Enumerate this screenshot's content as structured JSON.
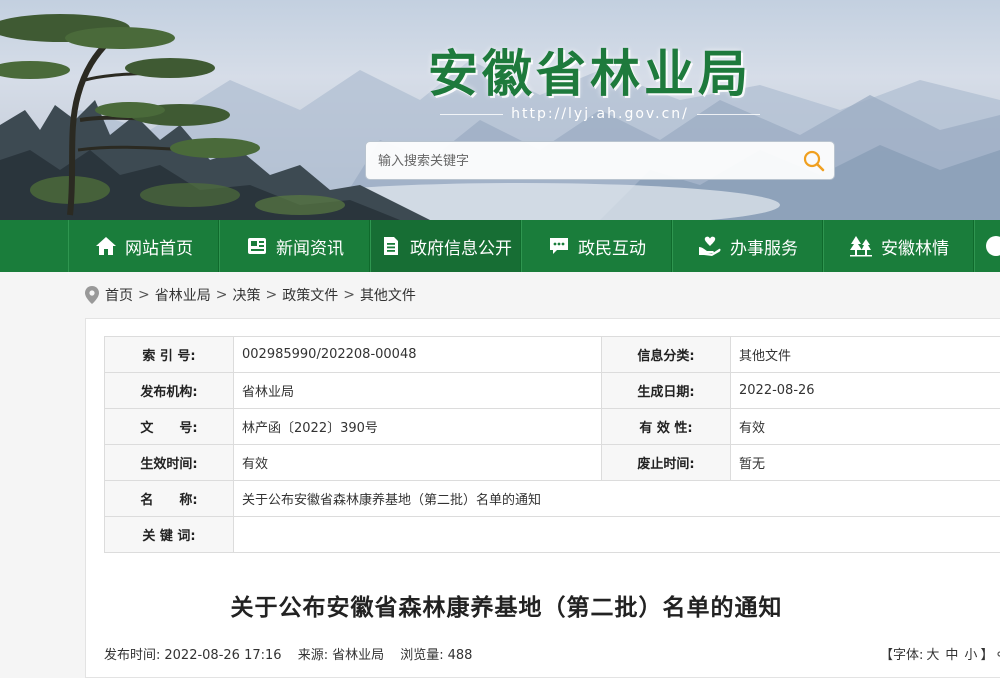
{
  "header": {
    "title": "安徽省林业局",
    "url": "http://lyj.ah.gov.cn/",
    "search": {
      "placeholder": "输入搜索关键字"
    }
  },
  "nav": {
    "items": [
      {
        "label": "网站首页",
        "icon": "home-icon"
      },
      {
        "label": "新闻资讯",
        "icon": "news-icon"
      },
      {
        "label": "政府信息公开",
        "icon": "document-icon"
      },
      {
        "label": "政民互动",
        "icon": "chat-icon"
      },
      {
        "label": "办事服务",
        "icon": "heart-hand-icon"
      },
      {
        "label": "安徽林情",
        "icon": "forest-icon"
      }
    ]
  },
  "breadcrumb": [
    "首页",
    "省林业局",
    "决策",
    "政策文件",
    "其他文件"
  ],
  "meta": {
    "index_label": "索 引 号:",
    "index_value": "002985990/202208-00048",
    "category_label": "信息分类:",
    "category_value": "其他文件",
    "publisher_label": "发布机构:",
    "publisher_value": "省林业局",
    "created_label": "生成日期:",
    "created_value": "2022-08-26",
    "docno_label": "文　　号:",
    "docno_value": "林产函〔2022〕390号",
    "validity_label": "有 效 性:",
    "validity_value": "有效",
    "effective_label": "生效时间:",
    "effective_value": "有效",
    "expire_label": "废止时间:",
    "expire_value": "暂无",
    "name_label": "名　　称:",
    "name_value": "关于公布安徽省森林康养基地（第二批）名单的通知",
    "keywords_label": "关 键 词:",
    "keywords_value": ""
  },
  "article": {
    "title": "关于公布安徽省森林康养基地（第二批）名单的通知",
    "publish_label": "发布时间:",
    "publish_time": "2022-08-26 17:16",
    "source_label": "来源:",
    "source": "省林业局",
    "views_label": "浏览量:",
    "views": "488",
    "fontsize_open": "【字体:",
    "fontsize_large": "大",
    "fontsize_medium": "中",
    "fontsize_small": "小",
    "fontsize_close": "】"
  },
  "colors": {
    "brand_green": "#1a7d3b",
    "title_green": "#1e7a3c"
  }
}
